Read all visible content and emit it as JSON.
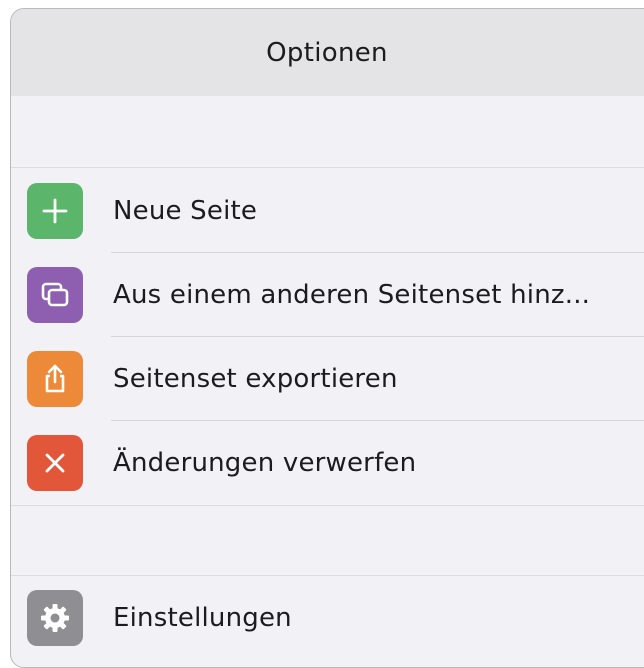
{
  "panel": {
    "title": "Optionen"
  },
  "menu": {
    "items": [
      {
        "label": "Neue Seite",
        "icon": "plus-icon",
        "color": "#5bb56a"
      },
      {
        "label": "Aus einem anderen Seitenset hinz...",
        "icon": "duplicate-pages-icon",
        "color": "#8e5fb1"
      },
      {
        "label": "Seitenset exportieren",
        "icon": "export-share-icon",
        "color": "#ec8a3a"
      },
      {
        "label": "Änderungen verwerfen",
        "icon": "close-x-icon",
        "color": "#e2573a"
      }
    ],
    "settings": {
      "label": "Einstellungen",
      "icon": "gear-icon",
      "color": "#8e8e93"
    }
  }
}
